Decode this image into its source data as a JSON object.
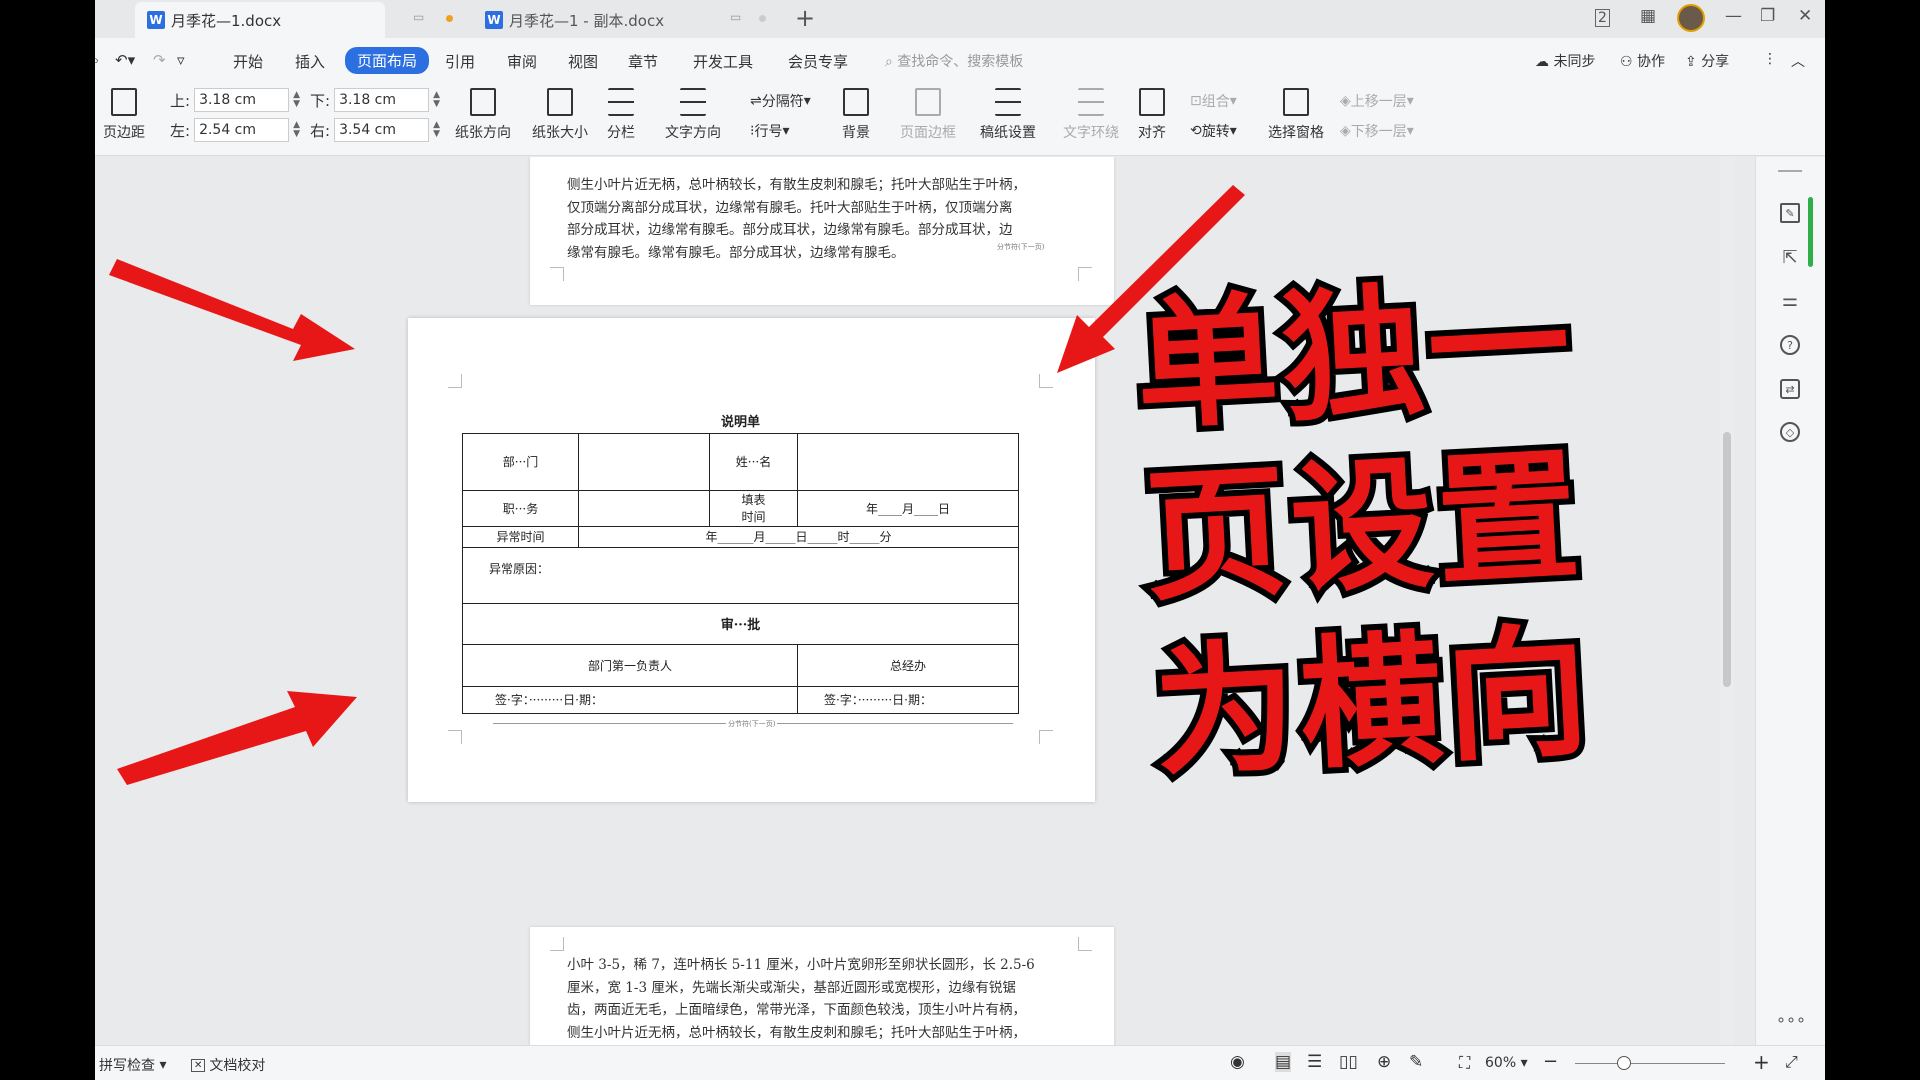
{
  "titlebar": {
    "tab1": "月季花—1.docx",
    "tab2": "月季花—1 - 副本.docx",
    "new_tab": "+",
    "win_minimize": "—",
    "win_restore": "❐",
    "win_close": "✕"
  },
  "menu": {
    "items": [
      "开始",
      "插入",
      "页面布局",
      "引用",
      "审阅",
      "视图",
      "章节",
      "开发工具",
      "会员专享"
    ],
    "search": "查找命令、搜索模板",
    "sync": "未同步",
    "collab": "协作",
    "share": "分享"
  },
  "ribbon": {
    "margins": "页边距",
    "top_label": "上:",
    "top_value": "3.18 cm",
    "bottom_label": "下:",
    "bottom_value": "3.18 cm",
    "left_label": "左:",
    "left_value": "2.54 cm",
    "right_label": "右:",
    "right_value": "3.54 cm",
    "orientation": "纸张方向",
    "size": "纸张大小",
    "columns": "分栏",
    "text_direction": "文字方向",
    "breaks": "分隔符",
    "line_numbers": "行号",
    "background": "背景",
    "page_border": "页面边框",
    "draft_paper": "稿纸设置",
    "text_wrap": "文字环绕",
    "align": "对齐",
    "group": "组合",
    "rotate": "旋转",
    "selection_pane": "选择窗格",
    "bring_forward": "上移一层",
    "send_backward": "下移一层"
  },
  "doc": {
    "page1_text": "侧生小叶片近无柄，总叶柄较长，有散生皮刺和腺毛；托叶大部贴生于叶柄，\n仅顶端分离部分成耳状，边缘常有腺毛。托叶大部贴生于叶柄，仅顶端分离\n部分成耳状，边缘常有腺毛。部分成耳状，边缘常有腺毛。部分成耳状，边\n缘常有腺毛。缘常有腺毛。部分成耳状，边缘常有腺毛。",
    "page1_break": "分节符(下一页)",
    "page3_text": "小叶 3-5，稀 7，连叶柄长 5-11 厘米，小叶片宽卵形至卵状长圆形，长 2.5-6\n厘米，宽 1-3 厘米，先端长渐尖或渐尖，基部近圆形或宽楔形，边缘有锐锯\n齿，两面近无毛，上面暗绿色，常带光泽，下面颜色较浅，顶生小叶片有柄，\n侧生小叶片近无柄，总叶柄较长，有散生皮刺和腺毛；托叶大部贴生于叶柄，",
    "form": {
      "title": "说明单",
      "dept": "部···门",
      "name": "姓···名",
      "position": "职···务",
      "fill_time_1": "填表",
      "fill_time_2": "时间",
      "date_ymd": "年____月____日",
      "abnormal_time": "异常时间",
      "abnormal_time_value": "年______月_____日_____时_____分",
      "abnormal_reason": "异常原因：",
      "approval": "审···批",
      "dept_head": "部门第一负责人",
      "gm_office": "总经办",
      "sign_1": "签·字：·········日·期：",
      "sign_2": "签·字：·········日·期："
    },
    "page2_break": "分节符(下一页)"
  },
  "overlay": {
    "line1": "单独一",
    "line2": "页设置",
    "line3": "为横向",
    "color": "#e81717"
  },
  "status": {
    "spell_check": "拼写检查",
    "doc_proof": "文档校对",
    "zoom": "60%",
    "zoom_out": "−",
    "zoom_in": "+"
  }
}
